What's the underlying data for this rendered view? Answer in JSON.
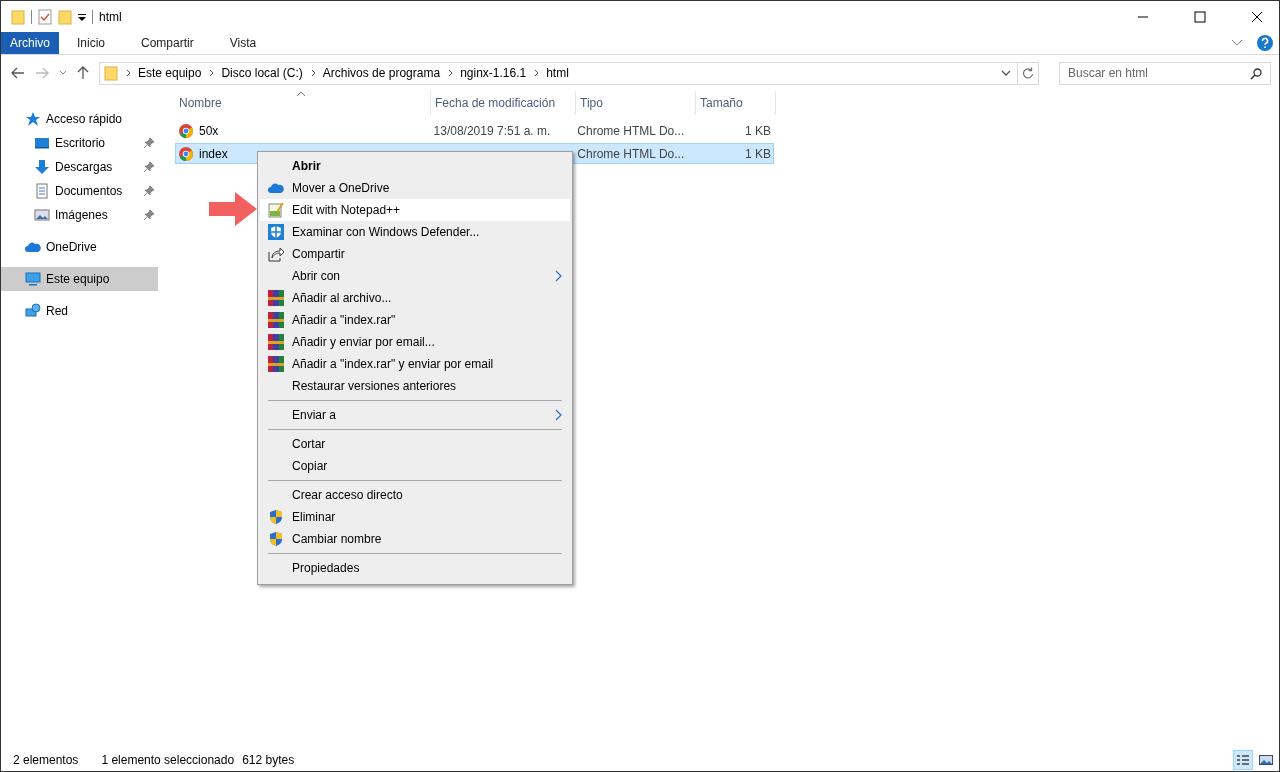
{
  "window": {
    "title": "html"
  },
  "ribbon": {
    "tabs": [
      {
        "label": "Archivo",
        "kind": "file"
      },
      {
        "label": "Inicio",
        "kind": "tab"
      },
      {
        "label": "Compartir",
        "kind": "tab"
      },
      {
        "label": "Vista",
        "kind": "tab"
      }
    ]
  },
  "address_bar": {
    "crumbs": [
      "Este equipo",
      "Disco local (C:)",
      "Archivos de programa",
      "nginx-1.16.1",
      "html"
    ]
  },
  "search": {
    "placeholder": "Buscar en html"
  },
  "sidebar": {
    "items": [
      {
        "label": "Acceso rápido",
        "kind": "star",
        "selected": false,
        "children": [
          {
            "label": "Escritorio",
            "kind": "desktop",
            "pinned": true,
            "selected": false
          },
          {
            "label": "Descargas",
            "kind": "download",
            "pinned": true,
            "selected": false
          },
          {
            "label": "Documentos",
            "kind": "document",
            "pinned": true,
            "selected": false
          },
          {
            "label": "Imágenes",
            "kind": "image",
            "pinned": true,
            "selected": false
          }
        ]
      },
      {
        "label": "OneDrive",
        "kind": "cloud",
        "selected": false
      },
      {
        "label": "Este equipo",
        "kind": "computer",
        "selected": true
      },
      {
        "label": "Red",
        "kind": "network",
        "selected": false
      }
    ]
  },
  "table": {
    "columns": [
      "Nombre",
      "Fecha de modificación",
      "Tipo",
      "Tamaño"
    ],
    "rows": [
      {
        "name": "50x",
        "modified": "13/08/2019 7:51 a. m.",
        "type": "Chrome HTML Do...",
        "size": "1 KB",
        "selected": false
      },
      {
        "name": "index",
        "type": "Chrome HTML Do...",
        "size": "1 KB",
        "selected": true
      }
    ]
  },
  "context_menu": {
    "items": [
      {
        "kind": "plain",
        "label": "Abrir",
        "bold": true,
        "selected": false
      },
      {
        "kind": "cloud",
        "label": "Mover a OneDrive",
        "selected": false
      },
      {
        "kind": "notepad",
        "label": "Edit with Notepad++",
        "selected": true
      },
      {
        "kind": "defender",
        "label": "Examinar con Windows Defender...",
        "selected": false
      },
      {
        "kind": "share",
        "label": "Compartir",
        "selected": false
      },
      {
        "kind": "plain",
        "label": "Abrir con",
        "submenu": true,
        "selected": false
      },
      {
        "kind": "rar",
        "label": "Añadir al archivo...",
        "selected": false
      },
      {
        "kind": "rar",
        "label": "Añadir a \"index.rar\"",
        "selected": false
      },
      {
        "kind": "rar",
        "label": "Añadir y enviar por email...",
        "selected": false
      },
      {
        "kind": "rar",
        "label": "Añadir a \"index.rar\" y enviar por email",
        "selected": false
      },
      {
        "kind": "plain",
        "label": "Restaurar versiones anteriores",
        "selected": false
      },
      {
        "kind": "separator"
      },
      {
        "kind": "plain",
        "label": "Enviar a",
        "submenu": true,
        "selected": false
      },
      {
        "kind": "separator"
      },
      {
        "kind": "plain",
        "label": "Cortar",
        "selected": false
      },
      {
        "kind": "plain",
        "label": "Copiar",
        "selected": false
      },
      {
        "kind": "separator"
      },
      {
        "kind": "plain",
        "label": "Crear acceso directo",
        "selected": false
      },
      {
        "kind": "shield",
        "label": "Eliminar",
        "selected": false
      },
      {
        "kind": "shield",
        "label": "Cambiar nombre",
        "selected": false
      },
      {
        "kind": "separator"
      },
      {
        "kind": "plain",
        "label": "Propiedades",
        "selected": false
      }
    ]
  },
  "status_bar": {
    "items": [
      "2 elementos",
      "1 elemento seleccionado",
      "612 bytes"
    ],
    "views": [
      {
        "kind": "details",
        "selected": true
      },
      {
        "kind": "large_icons",
        "selected": false
      }
    ]
  }
}
